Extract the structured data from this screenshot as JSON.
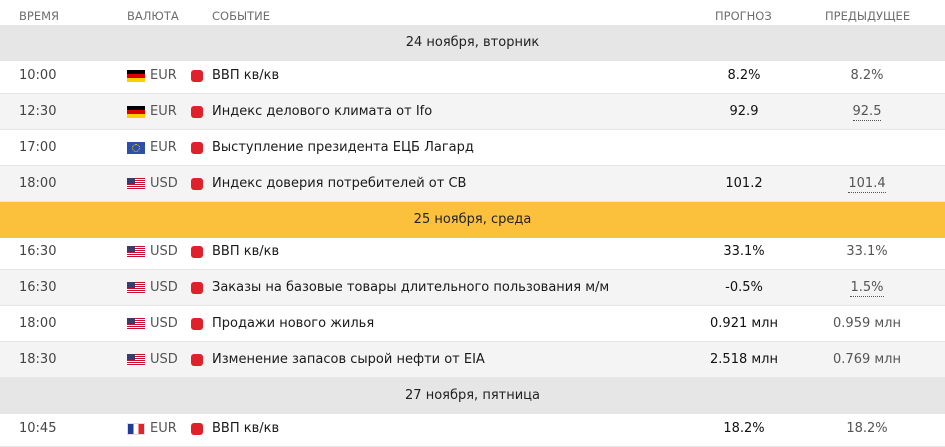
{
  "header": {
    "time": "ВРЕМЯ",
    "currency": "ВАЛЮТА",
    "event": "СОБЫТИЕ",
    "forecast": "ПРОГНОЗ",
    "previous": "ПРЕДЫДУЩЕЕ"
  },
  "colors": {
    "header_bg": "#ffffff",
    "date_row_bg": "#e6e6e6",
    "date_row_active_bg": "#fcc13c",
    "importance_high": "#e0212b"
  },
  "dates": {
    "d1": "24 ноября, вторник",
    "d2": "25 ноября, среда",
    "d3": "27 ноября, пятница"
  },
  "events": [
    {
      "time": "10:00",
      "flag": "germany-flag-icon",
      "currency": "EUR",
      "importance": "high",
      "event": "ВВП кв/кв",
      "forecast": "8.2%",
      "previous": "8.2%"
    },
    {
      "time": "12:30",
      "flag": "germany-flag-icon",
      "currency": "EUR",
      "importance": "high",
      "event": "Индекс делового климата от Ifo",
      "forecast": "92.9",
      "previous": "92.5"
    },
    {
      "time": "17:00",
      "flag": "eu-flag-icon",
      "currency": "EUR",
      "importance": "high",
      "event": "Выступление президента ЕЦБ Лагард",
      "forecast": "",
      "previous": ""
    },
    {
      "time": "18:00",
      "flag": "usa-flag-icon",
      "currency": "USD",
      "importance": "high",
      "event": "Индекс доверия потребителей от CB",
      "forecast": "101.2",
      "previous": "101.4"
    },
    {
      "time": "16:30",
      "flag": "usa-flag-icon",
      "currency": "USD",
      "importance": "high",
      "event": "ВВП кв/кв",
      "forecast": "33.1%",
      "previous": "33.1%"
    },
    {
      "time": "16:30",
      "flag": "usa-flag-icon",
      "currency": "USD",
      "importance": "high",
      "event": "Заказы на базовые товары длительного пользования м/м",
      "forecast": "-0.5%",
      "previous": "1.5%"
    },
    {
      "time": "18:00",
      "flag": "usa-flag-icon",
      "currency": "USD",
      "importance": "high",
      "event": "Продажи нового жилья",
      "forecast": "0.921 млн",
      "previous": "0.959 млн"
    },
    {
      "time": "18:30",
      "flag": "usa-flag-icon",
      "currency": "USD",
      "importance": "high",
      "event": "Изменение запасов сырой нефти от EIA",
      "forecast": "2.518 млн",
      "previous": "0.769 млн"
    },
    {
      "time": "10:45",
      "flag": "france-flag-icon",
      "currency": "EUR",
      "importance": "high",
      "event": "ВВП кв/кв",
      "forecast": "18.2%",
      "previous": "18.2%"
    }
  ]
}
